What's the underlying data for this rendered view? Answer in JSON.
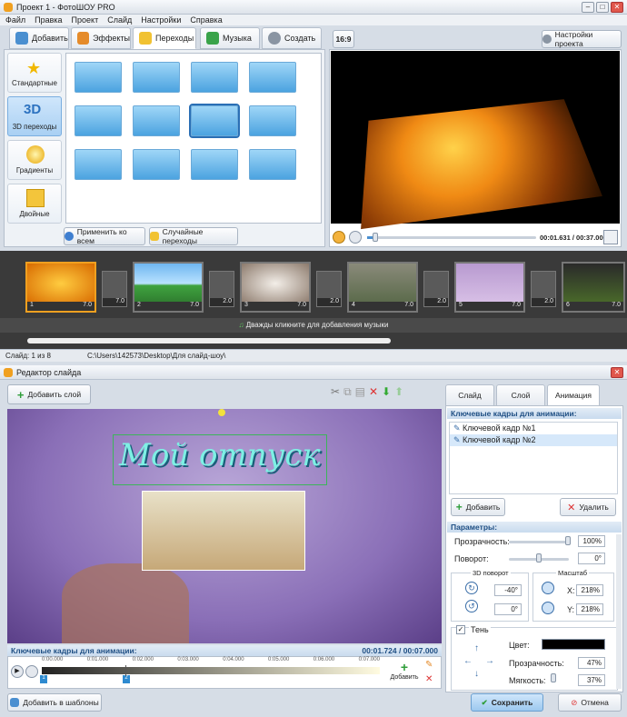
{
  "app": {
    "title": "Проект 1 - ФотоШОУ PRO",
    "menu": [
      "Файл",
      "Правка",
      "Проект",
      "Слайд",
      "Настройки",
      "Справка"
    ]
  },
  "tabs": [
    "Добавить",
    "Эффекты",
    "Переходы",
    "Музыка",
    "Создать"
  ],
  "aspect": "16:9",
  "project_settings": "Настройки проекта",
  "categories": [
    "Стандартные",
    "3D переходы",
    "Градиенты",
    "Двойные"
  ],
  "category_3d_badge": "3D",
  "apply_all": "Применить ко всем",
  "random_transitions": "Случайные переходы",
  "player": {
    "time": "00:01.631 / 00:37.000"
  },
  "timeline": {
    "slides": [
      {
        "n": "1",
        "d": "7.0"
      },
      {
        "n": "2",
        "d": "7.0"
      },
      {
        "n": "3",
        "d": "7.0"
      },
      {
        "n": "4",
        "d": "7.0"
      },
      {
        "n": "5",
        "d": "7.0"
      },
      {
        "n": "6",
        "d": "7.0"
      }
    ],
    "transitions": [
      "7.0",
      "2.0",
      "2.0",
      "2.0",
      "2.0"
    ],
    "music_hint": "Дважды кликните для добавления музыки"
  },
  "statusbar": {
    "slide": "Слайд: 1 из 8",
    "path": "C:\\Users\\142573\\Desktop\\Для слайд-шоу\\"
  },
  "editor": {
    "title": "Редактор слайда",
    "add_layer": "Добавить слой",
    "caption": "Мой отпуск",
    "side_tabs": [
      "Слайд",
      "Слой",
      "Анимация"
    ],
    "keyframes_header": "Ключевые кадры для анимации:",
    "keyframes": [
      "Ключевой кадр №1",
      "Ключевой кадр №2"
    ],
    "add": "Добавить",
    "delete": "Удалить",
    "params_header": "Параметры:",
    "opacity_label": "Прозрачность:",
    "opacity": "100%",
    "rotation_label": "Поворот:",
    "rotation": "0°",
    "rot3d_label": "3D поворот",
    "rot3d_a": "-40°",
    "rot3d_b": "0°",
    "scale_label": "Масштаб",
    "scale_x_label": "X:",
    "scale_x": "218%",
    "scale_y_label": "Y:",
    "scale_y": "218%",
    "shadow_label": "Тень",
    "color_label": "Цвет:",
    "shadow_opacity_label": "Прозрачность:",
    "shadow_opacity": "47%",
    "softness_label": "Мягкость:",
    "softness": "37%",
    "timeline_header": "Ключевые кадры для анимации:",
    "timeline_time": "00:01.724 / 00:07.000",
    "ruler": [
      "0:00.000",
      "0:01.000",
      "0:02.000",
      "0:03.000",
      "0:04.000",
      "0:05.000",
      "0:06.000",
      "0:07.000"
    ],
    "markers": [
      "1",
      "2"
    ],
    "add_small": "Добавить",
    "templates": "Добавить в шаблоны",
    "save": "Сохранить",
    "cancel": "Отмена"
  }
}
